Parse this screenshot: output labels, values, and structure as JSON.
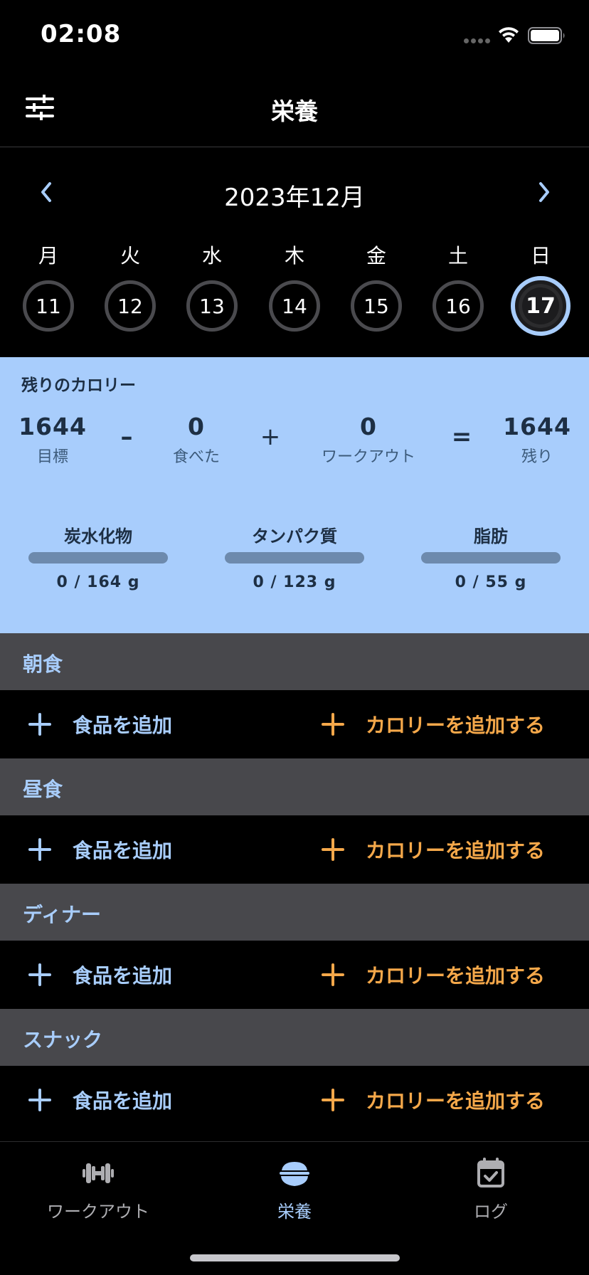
{
  "status_bar": {
    "time": "02:08"
  },
  "header": {
    "title": "栄養"
  },
  "calendar": {
    "month_label": "2023年12月",
    "weekdays": [
      "月",
      "火",
      "水",
      "木",
      "金",
      "土",
      "日"
    ],
    "days": [
      "11",
      "12",
      "13",
      "14",
      "15",
      "16",
      "17"
    ],
    "selected_day": "17"
  },
  "summary": {
    "title": "残りのカロリー",
    "goal": {
      "value": "1644",
      "label": "目標"
    },
    "eaten": {
      "value": "0",
      "label": "食べた"
    },
    "workout": {
      "value": "0",
      "label": "ワークアウト"
    },
    "remaining": {
      "value": "1644",
      "label": "残り"
    },
    "operators": {
      "minus": "–",
      "plus": "+",
      "equals": "="
    },
    "macros": [
      {
        "name": "炭水化物",
        "value": "0 / 164 g",
        "progress": 0
      },
      {
        "name": "タンパク質",
        "value": "0 / 123 g",
        "progress": 0
      },
      {
        "name": "脂肪",
        "value": "0 / 55 g",
        "progress": 0
      }
    ]
  },
  "meals": [
    {
      "name": "朝食",
      "add_food_label": "食品を追加",
      "add_calories_label": "カロリーを追加する"
    },
    {
      "name": "昼食",
      "add_food_label": "食品を追加",
      "add_calories_label": "カロリーを追加する"
    },
    {
      "name": "ディナー",
      "add_food_label": "食品を追加",
      "add_calories_label": "カロリーを追加する"
    },
    {
      "name": "スナック",
      "add_food_label": "食品を追加",
      "add_calories_label": "カロリーを追加する"
    }
  ],
  "tab_bar": {
    "tabs": [
      {
        "label": "ワークアウト",
        "icon": "dumbbell-icon"
      },
      {
        "label": "栄養",
        "icon": "rice-bowl-icon",
        "active": true
      },
      {
        "label": "ログ",
        "icon": "calendar-check-icon"
      }
    ]
  },
  "colors": {
    "accent": "#a8cdfc",
    "add_calories": "#f5a84a",
    "meal_header_bg": "#48484c",
    "summary_bg": "#a8cdfc"
  }
}
